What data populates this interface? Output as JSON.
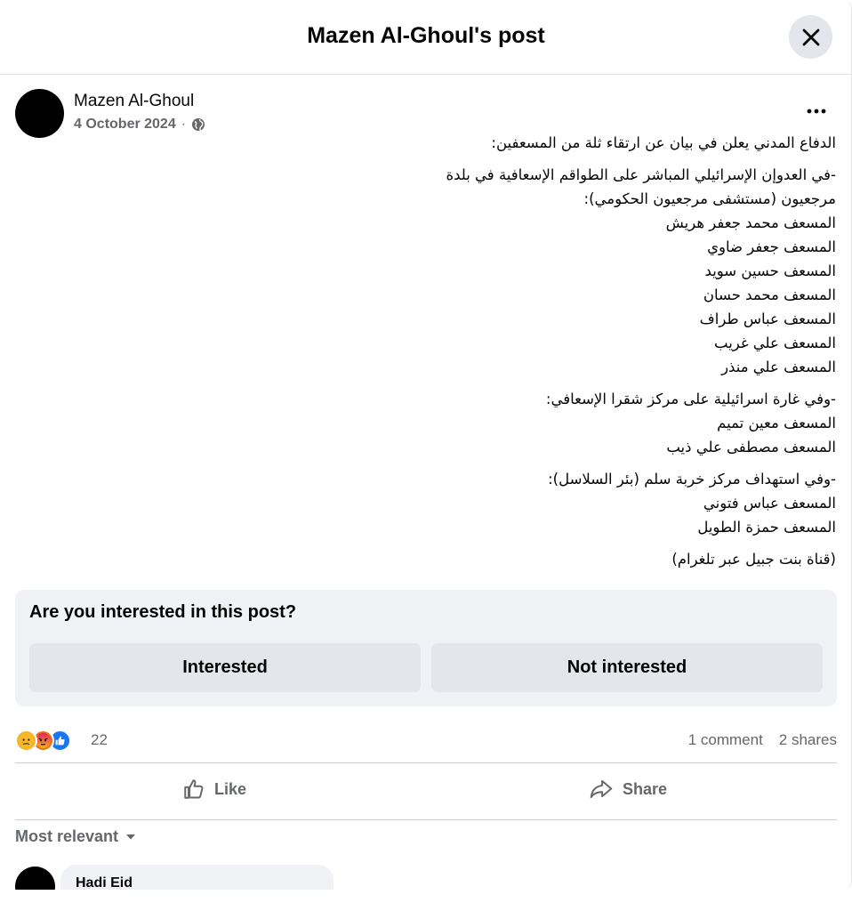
{
  "header": {
    "title": "Mazen Al-Ghoul's post",
    "close_icon": "close-icon"
  },
  "post": {
    "author": "Mazen Al-Ghoul",
    "date": "4 October 2024",
    "separator": "·",
    "privacy_icon": "globe-icon",
    "more_icon": "more-horizontal-icon",
    "paragraphs": [
      [
        "الدفاع المدني يعلن في بيان عن ارتقاء ثلة من المسعفين:"
      ],
      [
        "-في العدوإن الإسرائيلي المباشر على الطواقم الإسعافية في بلدة",
        "مرجعيون (مستشفى مرجعيون الحكومي):",
        "المسعف محمد جعفر هريش",
        "المسعف جعفر ضاوي",
        "المسعف حسين سويد",
        "المسعف محمد حسان",
        "المسعف عباس طراف",
        "المسعف علي غريب",
        "المسعف علي منذر"
      ],
      [
        "-وفي غارة اسرائيلية على مركز شقرا  الإسعافي:",
        "المسعف معين تميم",
        "المسعف مصطفى علي ذيب"
      ],
      [
        "-وفي استهداف مركز خربة سلم (بئر السلاسل):",
        "المسعف عباس فتوني",
        "المسعف حمزة الطويل"
      ],
      [
        "(قناة بنت جبيل عبر تلغرام)"
      ]
    ]
  },
  "interest": {
    "question": "Are you interested in this post?",
    "interested_label": "Interested",
    "not_interested_label": "Not interested"
  },
  "engagement": {
    "reactions": [
      "sad-reaction-icon",
      "angry-reaction-icon",
      "like-reaction-icon"
    ],
    "reaction_count": "22",
    "comments": "1 comment",
    "shares": "2 shares"
  },
  "actions": {
    "like_label": "Like",
    "share_label": "Share"
  },
  "comments": {
    "sort_label": "Most relevant",
    "first_author": "Hadi Eid"
  },
  "colors": {
    "secondary_text": "#65676b",
    "card_bg": "#f0f2f5",
    "button_bg": "#e4e6eb",
    "like_blue": "#1877f2"
  }
}
